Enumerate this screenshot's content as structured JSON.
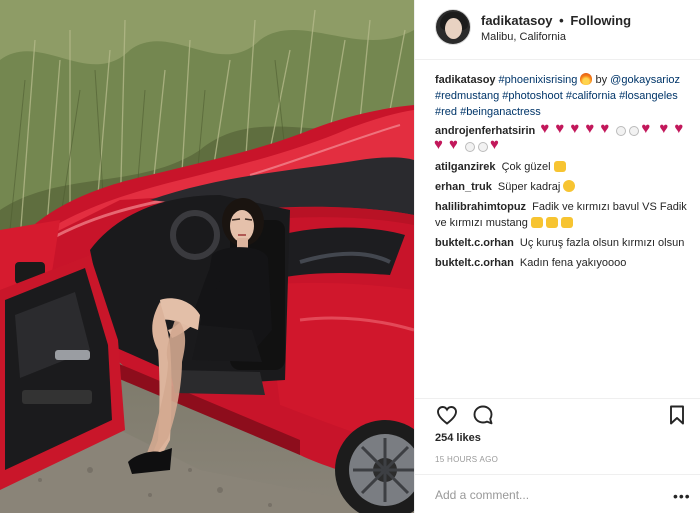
{
  "post": {
    "username": "fadikatasoy",
    "separator": "•",
    "follow_status": "Following",
    "location": "Malibu, California",
    "caption": {
      "username": "fadikatasoy",
      "tag1": "#phoenixisrising",
      "by": "by",
      "mention": "@gokaysarioz",
      "tags_rest": "#redmustang #photoshoot #california #losangeles #red #beinganactress"
    },
    "comments": [
      {
        "username": "androjenferhatsirin",
        "text": ""
      },
      {
        "username": "atilganzirek",
        "text": "Çok güzel"
      },
      {
        "username": "erhan_truk",
        "text": "Süper kadraj"
      },
      {
        "username": "halilibrahimtopuz",
        "text": "Fadik ve kırmızı bavul VS Fadik ve kırmızı mustang"
      },
      {
        "username": "buktelt.c.orhan",
        "text": "Uç kuruş fazla olsun kırmızı olsun"
      },
      {
        "username": "buktelt.c.orhan",
        "text": "Kadın fena yakıyoooo"
      }
    ],
    "likes": "254 likes",
    "timestamp": "15 HOURS AGO",
    "add_comment_placeholder": "Add a comment...",
    "more_label": "•••"
  },
  "icons": {
    "like": "heart-outline-icon",
    "comment": "speech-bubble-icon",
    "save": "bookmark-icon",
    "fire_emoji": "fire-emoji",
    "heart_emoji": "red-heart-emoji",
    "thumbs_emoji": "thumbs-up-emoji",
    "ok_emoji": "ok-hand-emoji"
  },
  "colors": {
    "link": "#003569",
    "car": "#d3182a",
    "meta": "#999999"
  }
}
